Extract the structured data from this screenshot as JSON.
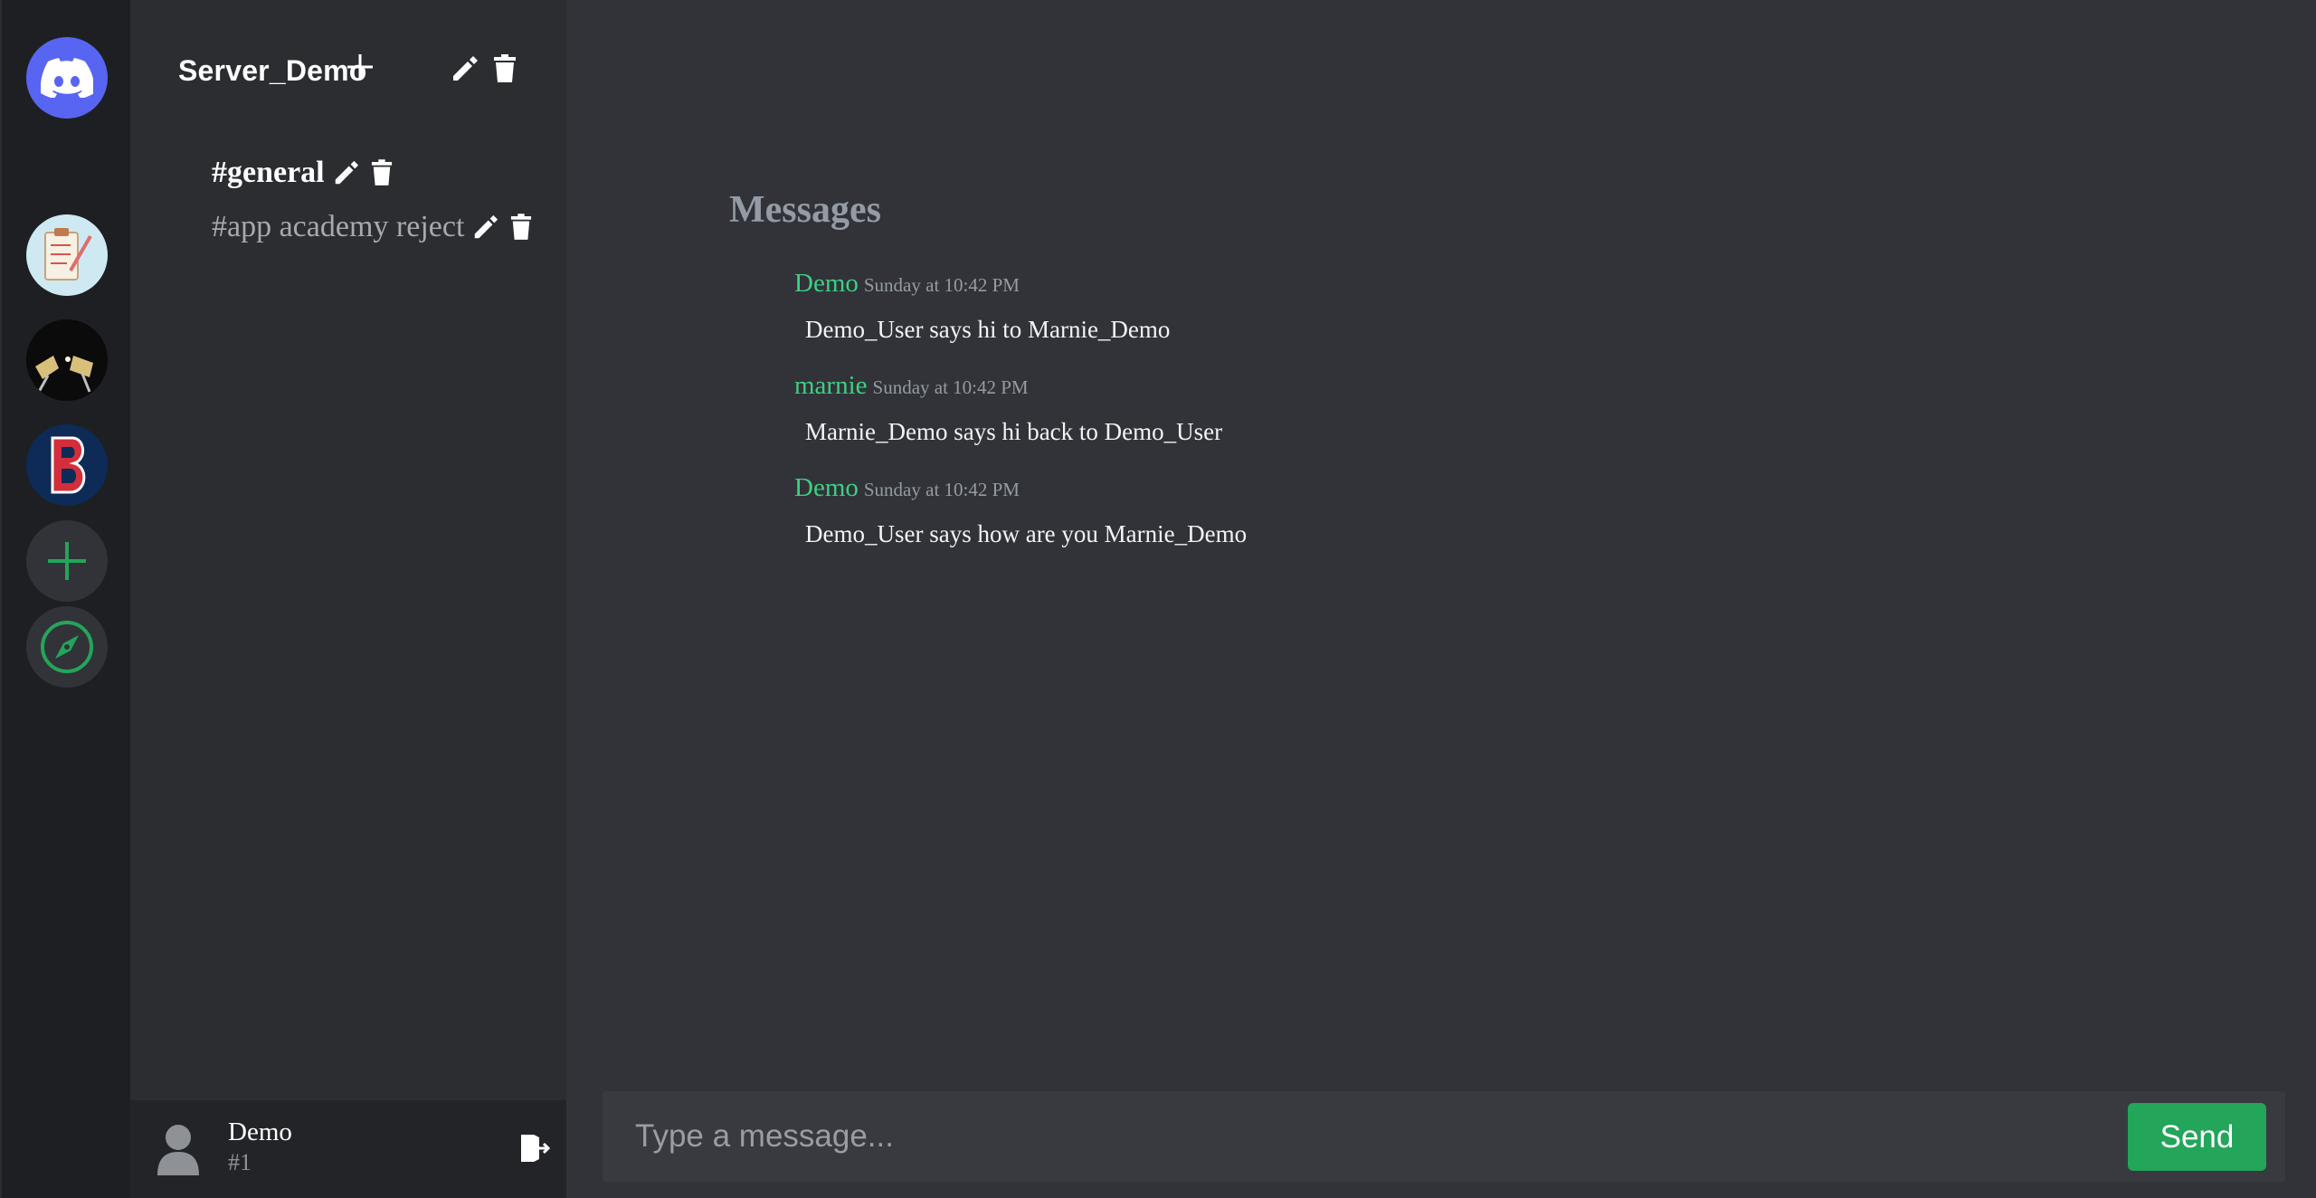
{
  "server": {
    "name": "Server_Demo"
  },
  "rail": {
    "icons": [
      "discord-logo-icon",
      "clipboard-icon",
      "champagne-toast-icon",
      "red-sox-b-icon",
      "plus-icon",
      "compass-icon"
    ]
  },
  "channels": [
    {
      "label": "#general",
      "active": true
    },
    {
      "label": "#app academy reject",
      "active": false
    }
  ],
  "user": {
    "name": "Demo",
    "tag": "#1"
  },
  "messages_panel": {
    "title": "Messages",
    "items": [
      {
        "author": "Demo",
        "time": "Sunday at 10:42 PM",
        "text": "Demo_User says hi to Marnie_Demo"
      },
      {
        "author": "marnie",
        "time": "Sunday at 10:42 PM",
        "text": "Marnie_Demo says hi back to Demo_User"
      },
      {
        "author": "Demo",
        "time": "Sunday at 10:42 PM",
        "text": "Demo_User says how are you Marnie_Demo"
      }
    ]
  },
  "composer": {
    "placeholder": "Type a message...",
    "value": "",
    "send_label": "Send"
  },
  "colors": {
    "accent_green": "#23a55a",
    "author_green": "#3ecf83",
    "discord_blurple": "#5865f2"
  }
}
